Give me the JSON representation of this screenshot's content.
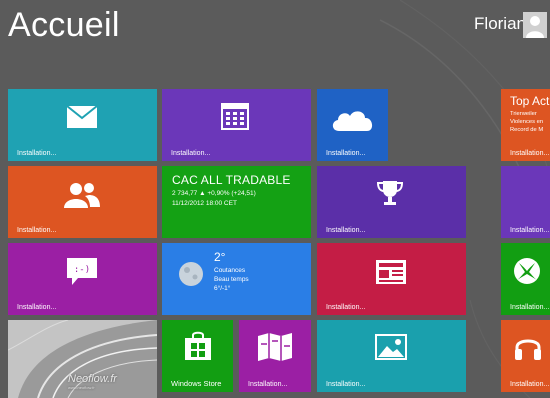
{
  "screen": {
    "title": "Accueil",
    "user_name": "Florian"
  },
  "tiles": {
    "mail": {
      "label": "Installation...",
      "color": "#1fa2b3",
      "icon": "mail-icon"
    },
    "calendar": {
      "label": "Installation...",
      "color": "#6b37b9",
      "icon": "calendar-icon"
    },
    "skydrive": {
      "label": "Installation...",
      "color": "#1f62c5",
      "icon": "cloud-icon"
    },
    "people": {
      "label": "Installation...",
      "color": "#dd5522",
      "icon": "people-icon"
    },
    "finance": {
      "color": "#14a114",
      "title": "CAC ALL TRADABLE",
      "line1": "2 734,77  ▲ +0,90% (+24,51)",
      "line2": "11/12/2012 18:00 CET"
    },
    "games": {
      "label": "Installation...",
      "color": "#5b2fa8",
      "icon": "trophy-icon"
    },
    "messaging": {
      "label": "Installation...",
      "color": "#9b1fa4",
      "icon": "chat-icon"
    },
    "weather": {
      "color": "#2a7ee6",
      "icon": "moon-icon",
      "temperature": "2°",
      "city": "Coutances",
      "condition": "Beau temps",
      "range": "6°/-1°"
    },
    "news": {
      "label": "Installation...",
      "color": "#c41d45",
      "icon": "newspaper-icon"
    },
    "desktop": {
      "watermark": "Neoflow.fr",
      "watermark_sub": "www.neoflow.fr"
    },
    "store": {
      "label": "Windows Store",
      "color": "#129e12",
      "icon": "store-bag-icon"
    },
    "maps": {
      "label": "Installation...",
      "color": "#9b1fa4",
      "icon": "map-icon"
    },
    "photos": {
      "label": "Installation...",
      "color": "#1aa0ad",
      "icon": "photo-icon"
    },
    "top_actu": {
      "color": "#dd5522",
      "title": "Top Act",
      "line1": "Trierweiler",
      "line2": "Violences en",
      "line3": "Record de M",
      "label": "Installation..."
    },
    "right_purple": {
      "label": "Installation...",
      "color": "#6b37b9"
    },
    "xbox_games": {
      "label": "Installation...",
      "color": "#129e12",
      "icon": "xbox-icon"
    },
    "music": {
      "label": "Installation...",
      "color": "#dd5522",
      "icon": "headphones-icon"
    }
  }
}
